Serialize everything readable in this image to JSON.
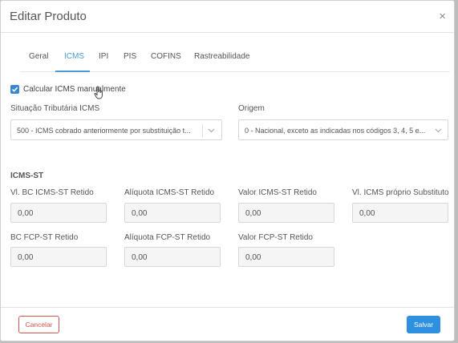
{
  "modal": {
    "title": "Editar Produto",
    "close_symbol": "×"
  },
  "tabs": [
    {
      "label": "Geral",
      "active": false
    },
    {
      "label": "ICMS",
      "active": true
    },
    {
      "label": "IPI",
      "active": false
    },
    {
      "label": "PIS",
      "active": false
    },
    {
      "label": "COFINS",
      "active": false
    },
    {
      "label": "Rastreabilidade",
      "active": false
    }
  ],
  "manual_icms": {
    "label": "Calcular ICMS manualmente",
    "checked": true
  },
  "situacao": {
    "label": "Situação Tributária ICMS",
    "value": "500 - ICMS cobrado anteriormente por substituição t..."
  },
  "origem": {
    "label": "Origem",
    "value": "0 - Nacional, exceto as indicadas nos códigos 3, 4, 5 e..."
  },
  "icms_st": {
    "title": "ICMS-ST",
    "fields": [
      {
        "label": "Vl. BC ICMS-ST Retido",
        "value": "0,00"
      },
      {
        "label": "Alíquota ICMS-ST Retido",
        "value": "0,00"
      },
      {
        "label": "Valor ICMS-ST Retido",
        "value": "0,00"
      },
      {
        "label": "Vl. ICMS próprio Substituto",
        "value": "0,00"
      },
      {
        "label": "BC FCP-ST Retido",
        "value": "0,00"
      },
      {
        "label": "Alíquota FCP-ST Retido",
        "value": "0,00"
      },
      {
        "label": "Valor FCP-ST Retido",
        "value": "0,00"
      }
    ]
  },
  "footer": {
    "cancel_label": "Cancelar",
    "save_label": "Salvar"
  },
  "colors": {
    "accent": "#4a9ad8",
    "danger": "#d9534f",
    "primary_button": "#2f8fe0"
  }
}
